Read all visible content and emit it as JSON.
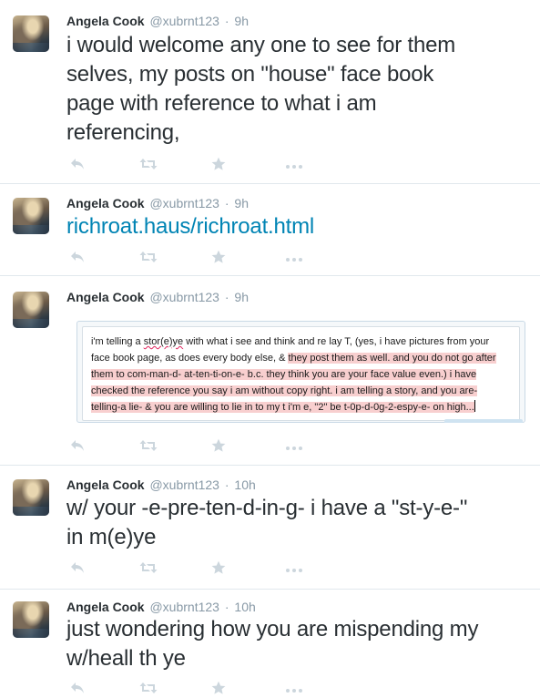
{
  "tweets": [
    {
      "name": "Angela Cook",
      "handle": "@xubrnt123",
      "separator": "·",
      "time": "9h",
      "text_lines": [
        "i would welcome any one to see for them",
        "selves, my posts on \"house\" face book",
        "page with reference to what i am",
        "referencing,"
      ]
    },
    {
      "name": "Angela Cook",
      "handle": "@xubrnt123",
      "separator": "·",
      "time": "9h",
      "link": "richroat.haus/richroat.html"
    },
    {
      "name": "Angela Cook",
      "handle": "@xubrnt123",
      "separator": "·",
      "time": "9h",
      "card": {
        "l1": "i'm telling a ",
        "l1_spell": "stor(e)ye",
        "l1_rest": " with what i see and think and re lay T, (yes, i have pictures from your",
        "l2_plain": "face book page, as does every body else, & ",
        "l2_hl": "they post them as well. and you do not go after",
        "l3_hl": "them to com-man-d- at-ten-ti-on-e- b.c. they think you are your face value even.) i have",
        "l4_hl": "checked the reference you say i am without copy right. i am telling a story, and you are-",
        "l5_hl": "telling-a lie- & you are willing to lie in to my t i'm e, \"2\" be t-0p-d-0g-2-espy-e- on high..."
      }
    },
    {
      "name": "Angela Cook",
      "handle": "@xubrnt123",
      "separator": "·",
      "time": "10h",
      "text_lines": [
        "w/ your -e-pre-ten-d-in-g- i have a \"st-y-e-\"",
        "in m(e)ye"
      ]
    },
    {
      "name": "Angela Cook",
      "handle": "@xubrnt123",
      "separator": "·",
      "time": "10h",
      "text_lines": [
        "just wondering how you are mispending my",
        "w/heall th ye"
      ]
    }
  ],
  "icons": {
    "reply": "reply-icon",
    "retweet": "retweet-icon",
    "favorite": "favorite-icon",
    "more": "more-icon"
  },
  "colors": {
    "action_icon": "#ccd6dd",
    "link": "#0084b4",
    "highlight": "#f8cfcf",
    "meta": "#8899a6"
  }
}
